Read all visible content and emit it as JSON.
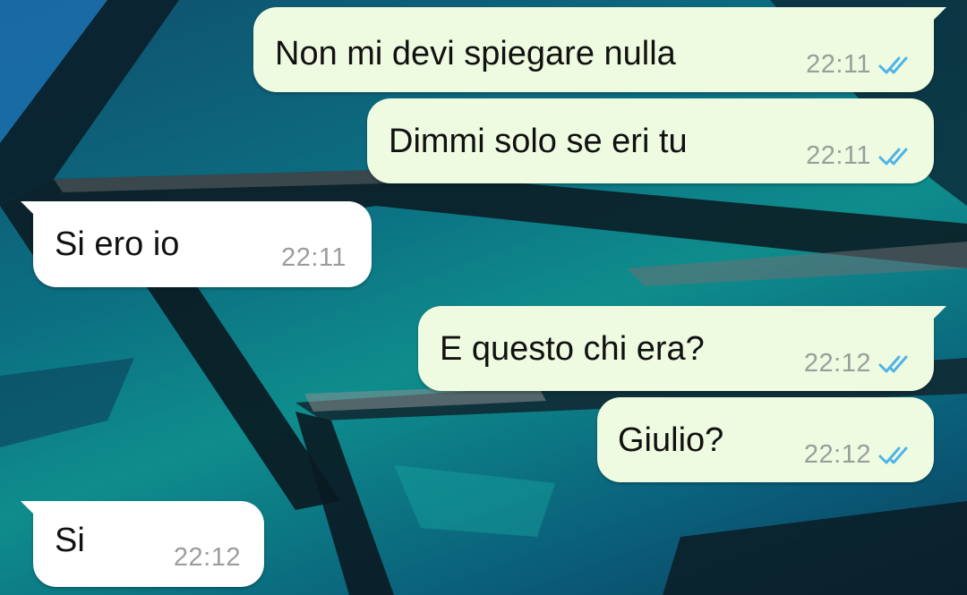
{
  "chat": {
    "colors": {
      "outgoing_bubble": "#eefbe0",
      "incoming_bubble": "#ffffff",
      "read_ticks": "#4fb3e8",
      "timestamp": "#9a9e9a"
    },
    "messages": [
      {
        "direction": "outgoing",
        "text": "Non mi devi spiegare nulla",
        "time": "22:11",
        "status": "read-double-check-icon"
      },
      {
        "direction": "outgoing",
        "text": "Dimmi solo se eri tu",
        "time": "22:11",
        "status": "read-double-check-icon"
      },
      {
        "direction": "incoming",
        "text": "Si ero io",
        "time": "22:11"
      },
      {
        "direction": "outgoing",
        "text": "E questo chi era?",
        "time": "22:12",
        "status": "read-double-check-icon"
      },
      {
        "direction": "outgoing",
        "text": "Giulio?",
        "time": "22:12",
        "status": "read-double-check-icon"
      },
      {
        "direction": "incoming",
        "text": "Si",
        "time": "22:12"
      }
    ]
  }
}
